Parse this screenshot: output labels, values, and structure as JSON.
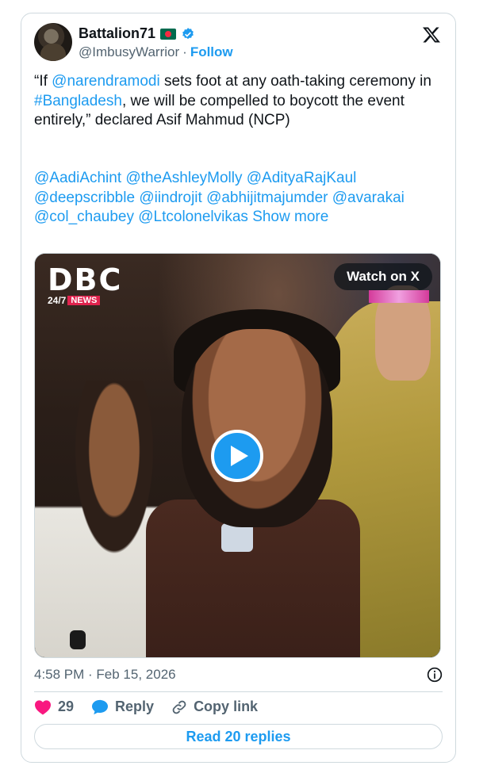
{
  "author": {
    "display_name": "Battalion71",
    "handle": "@ImbusyWarrior",
    "separator": "·",
    "follow_label": "Follow"
  },
  "tweet": {
    "text_parts": {
      "p1": "“If ",
      "mention1": "@narendramodi",
      "p2": " sets foot at any oath-taking ceremony in ",
      "hashtag": "#Bangladesh",
      "p3": ", we will be compelled to boycott the event entirely,” declared Asif Mahmud (NCP)"
    },
    "mentions": [
      "@AadiAchint",
      "@theAshleyMolly",
      "@AdityaRajKaul",
      "@deepscribble",
      "@iindrojit",
      "@abhijitmajumder",
      "@avarakai",
      "@col_chaubey",
      "@Ltcolonelvikas"
    ],
    "show_more": "Show more"
  },
  "media": {
    "logo_main": "DBC",
    "logo_247": "24/7",
    "logo_news": "NEWS",
    "watch_label": "Watch on X"
  },
  "meta": {
    "timestamp": "4:58 PM · Feb 15, 2026"
  },
  "actions": {
    "like_count": "29",
    "reply_label": "Reply",
    "copy_label": "Copy link",
    "read_replies": "Read 20 replies"
  },
  "colors": {
    "link": "#1d9bf0",
    "like": "#f91880",
    "text": "#0f1419",
    "muted": "#536471"
  }
}
